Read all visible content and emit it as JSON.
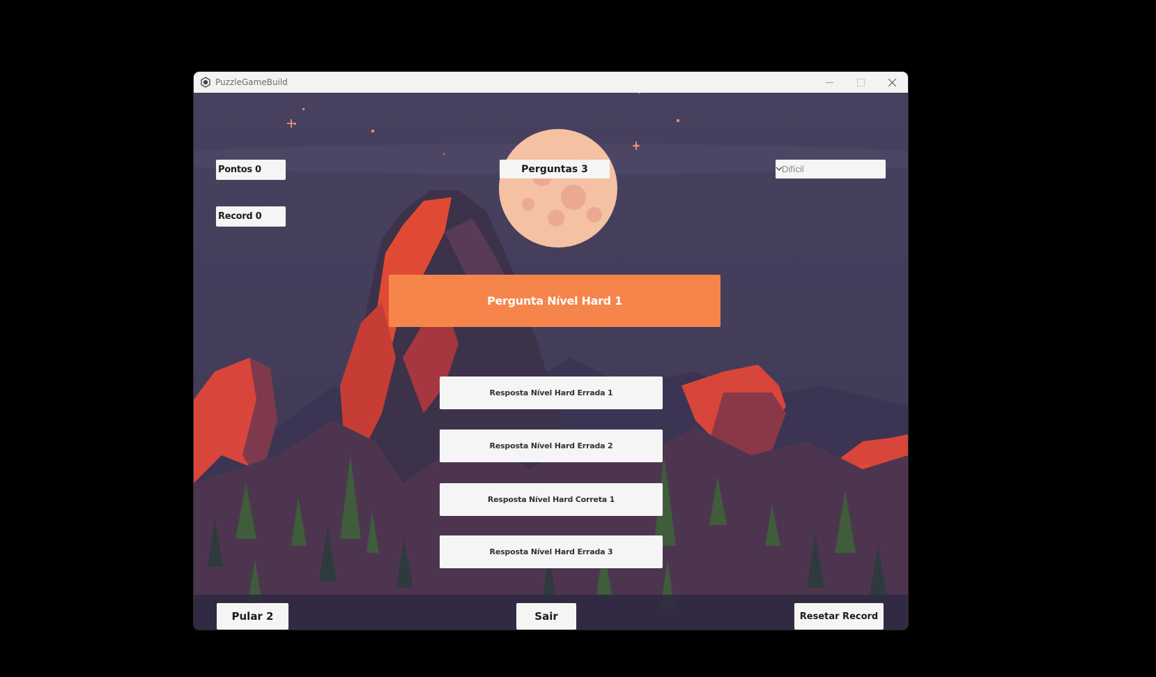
{
  "window": {
    "title": "PuzzleGameBuild",
    "app_icon": "unity-icon",
    "controls": [
      "minimize-icon",
      "maximize-icon",
      "close-icon"
    ]
  },
  "hud": {
    "points_label": "Pontos 0",
    "record_label": "Record 0",
    "questions_label": "Perguntas  3",
    "difficulty": {
      "selected": "Difícil",
      "icon": "chevron-down-icon"
    }
  },
  "question": {
    "text": "Pergunta Nível Hard 1"
  },
  "answers": [
    "Resposta Nível Hard Errada 1",
    "Resposta Nível Hard Errada 2",
    "Resposta Nível Hard Correta 1",
    "Resposta Nível Hard Errada 3"
  ],
  "footer": {
    "skip_label": "Pular 2",
    "exit_label": "Sair",
    "reset_label": "Resetar Record"
  },
  "colors": {
    "sky": "#45405e",
    "question_bg": "#f5854a",
    "button_bg": "#f5f5f5",
    "rock": "#e04a35",
    "moon": "#f4c1a3"
  }
}
